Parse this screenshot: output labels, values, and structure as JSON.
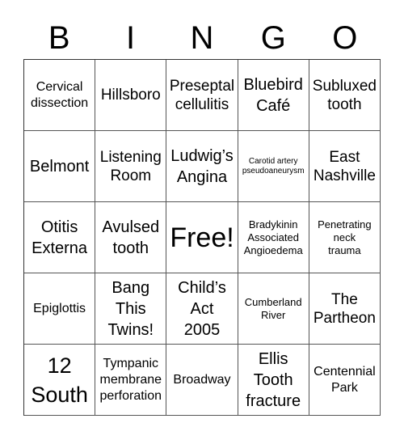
{
  "header": {
    "letters": [
      "B",
      "I",
      "N",
      "G",
      "O"
    ]
  },
  "grid": {
    "rows": [
      [
        "Cervical\ndissection",
        "Hillsboro",
        "Preseptal\ncellulitis",
        "Bluebird\nCafé",
        "Subluxed\ntooth"
      ],
      [
        "Belmont",
        "Listening\nRoom",
        "Ludwig’s\nAngina",
        "Carotid artery\npseudoaneurysm",
        "East\nNashville"
      ],
      [
        "Otitis\nExterna",
        "Avulsed\ntooth",
        "Free!",
        "Bradykinin\nAssociated\nAngioedema",
        "Penetrating\nneck\ntrauma"
      ],
      [
        "Epiglottis",
        "Bang\nThis\nTwins!",
        "Child’s\nAct\n2005",
        "Cumberland\nRiver",
        "The\nPartheon"
      ],
      [
        "12\nSouth",
        "Tympanic\nmembrane\nperforation",
        "Broadway",
        "Ellis\nTooth\nfracture",
        "Centennial\nPark"
      ]
    ],
    "free_space": "Free!"
  }
}
